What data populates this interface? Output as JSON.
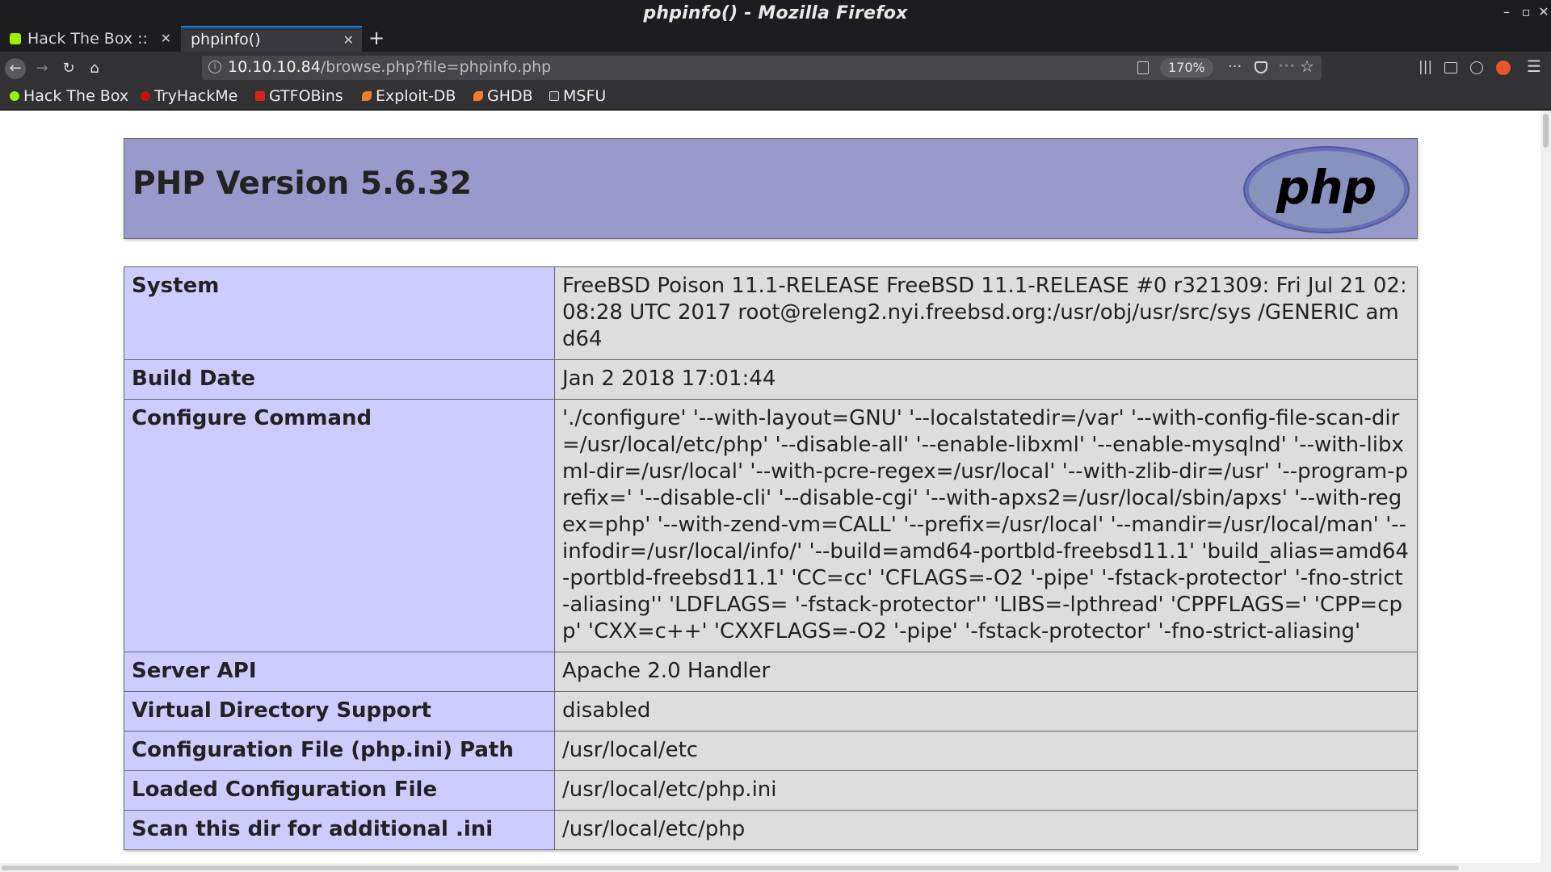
{
  "window": {
    "title": "phpinfo() - Mozilla Firefox"
  },
  "tabs": [
    {
      "label": "Hack The Box :: M",
      "active": false,
      "favicon_color": "#9fef00"
    },
    {
      "label": "phpinfo()",
      "active": true
    }
  ],
  "navbar": {
    "url_host": "10.10.10.84",
    "url_path": "/browse.php?file=phpinfo.php",
    "zoom": "170%"
  },
  "bookmarks": [
    {
      "label": "Hack The Box",
      "icon": "htb-icon",
      "color": "#9fef00"
    },
    {
      "label": "TryHackMe",
      "icon": "thm-icon",
      "color": "#c11111"
    },
    {
      "label": "GTFOBins",
      "icon": "gtfobins-icon",
      "color": "#d7261b"
    },
    {
      "label": "Exploit-DB",
      "icon": "exploitdb-icon",
      "color": "#f57c2b"
    },
    {
      "label": "GHDB",
      "icon": "ghdb-icon",
      "color": "#f57c2b"
    },
    {
      "label": "MSFU",
      "icon": "msfu-icon",
      "color": "#e0e0e0"
    }
  ],
  "page": {
    "heading": "PHP Version 5.6.32",
    "logo_text": "php",
    "rows": [
      {
        "key": "System",
        "value": "FreeBSD Poison 11.1-RELEASE FreeBSD 11.1-RELEASE #0 r321309: Fri Jul 21 02:08:28 UTC 2017 root@releng2.nyi.freebsd.org:/usr/obj/usr/src/sys /GENERIC amd64"
      },
      {
        "key": "Build Date",
        "value": "Jan 2 2018 17:01:44"
      },
      {
        "key": "Configure Command",
        "value": "'./configure' '--with-layout=GNU' '--localstatedir=/var' '--with-config-file-scan-dir=/usr/local/etc/php' '--disable-all' '--enable-libxml' '--enable-mysqlnd' '--with-libxml-dir=/usr/local' '--with-pcre-regex=/usr/local' '--with-zlib-dir=/usr' '--program-prefix=' '--disable-cli' '--disable-cgi' '--with-apxs2=/usr/local/sbin/apxs' '--with-regex=php' '--with-zend-vm=CALL' '--prefix=/usr/local' '--mandir=/usr/local/man' '--infodir=/usr/local/info/' '--build=amd64-portbld-freebsd11.1' 'build_alias=amd64-portbld-freebsd11.1' 'CC=cc' 'CFLAGS=-O2 '-pipe' '-fstack-protector' '-fno-strict-aliasing'' 'LDFLAGS= '-fstack-protector'' 'LIBS=-lpthread' 'CPPFLAGS=' 'CPP=cpp' 'CXX=c++' 'CXXFLAGS=-O2 '-pipe' '-fstack-protector' '-fno-strict-aliasing'"
      },
      {
        "key": "Server API",
        "value": "Apache 2.0 Handler"
      },
      {
        "key": "Virtual Directory Support",
        "value": "disabled"
      },
      {
        "key": "Configuration File (php.ini) Path",
        "value": "/usr/local/etc"
      },
      {
        "key": "Loaded Configuration File",
        "value": "/usr/local/etc/php.ini"
      },
      {
        "key": "Scan this dir for additional .ini",
        "value": "/usr/local/etc/php"
      }
    ]
  },
  "colors": {
    "header_bg": "#9999cc",
    "key_bg": "#ccccff",
    "value_bg": "#dddddd",
    "accent": "#0a84ff"
  }
}
